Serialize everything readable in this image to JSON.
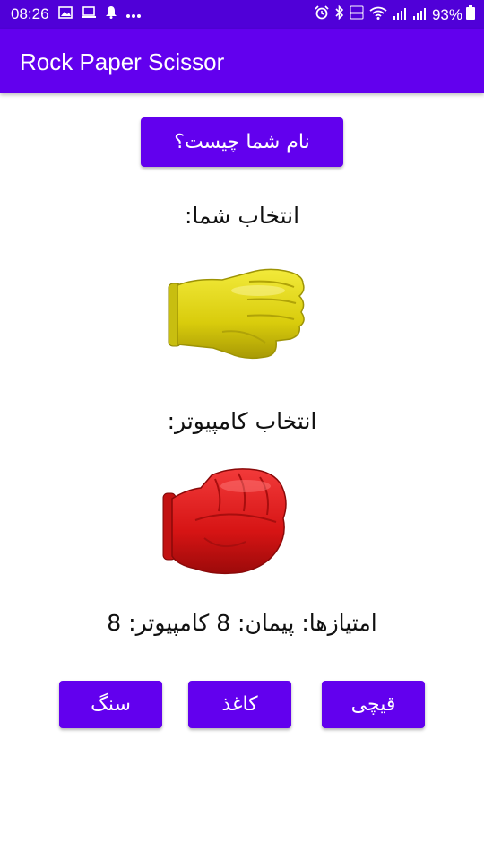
{
  "status_bar": {
    "time": "08:26",
    "left_icons": [
      "gallery-icon",
      "laptop-icon",
      "notification-bell-icon",
      "more-dots-icon"
    ],
    "right_icons": [
      "alarm-icon",
      "bluetooth-icon",
      "volte-icon",
      "wifi-icon",
      "signal-icon",
      "signal-icon",
      "battery-icon"
    ],
    "battery": "93%"
  },
  "app_bar": {
    "title": "Rock Paper Scissor"
  },
  "name_button": "نام شما چیست؟",
  "user_choice_label": "انتخاب شما:",
  "user_choice_icon": "paper-hand-icon",
  "computer_choice_label": "انتخاب کامپیوتر:",
  "computer_choice_icon": "rock-fist-icon",
  "score_text": "امتیازها: پیمان: 8 کامپیوتر: 8",
  "move_buttons": {
    "scissors": "قیچی",
    "paper": "کاغذ",
    "rock": "سنگ"
  },
  "colors": {
    "status_bar": "#5000d8",
    "primary": "#6200ee",
    "user_hand": "#e0d40f",
    "computer_hand": "#d81818"
  }
}
